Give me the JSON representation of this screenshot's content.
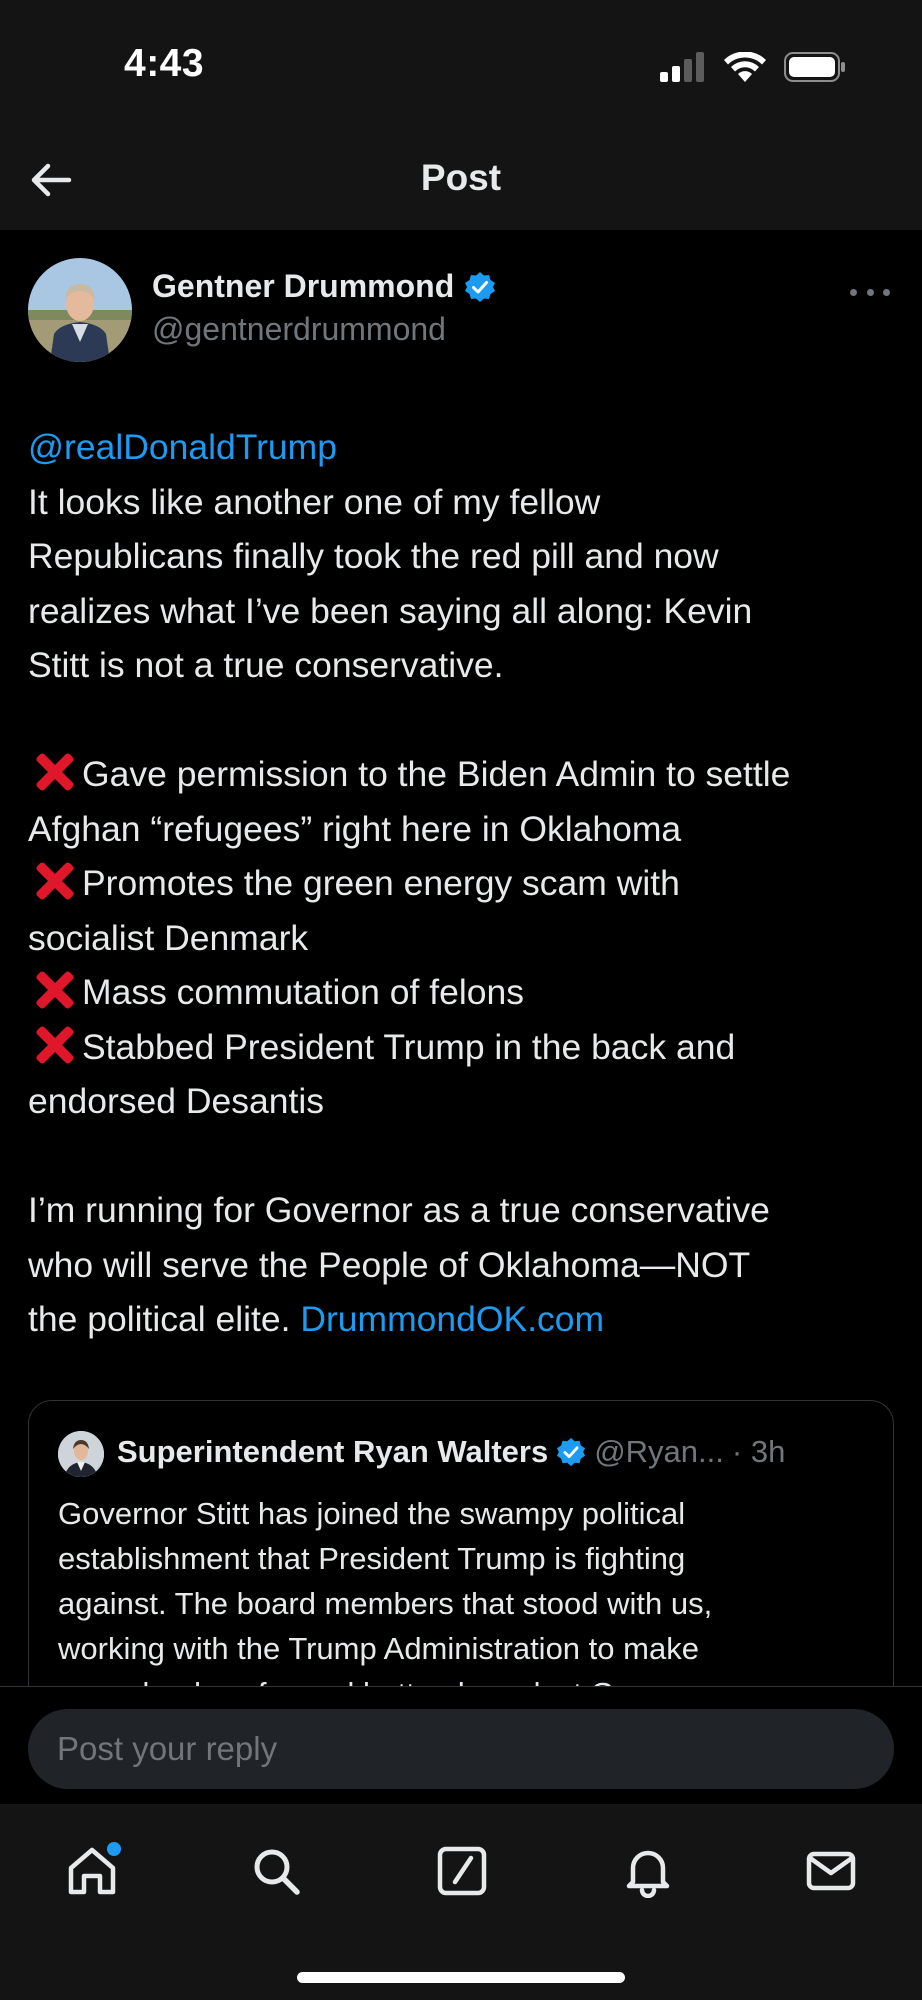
{
  "status_bar": {
    "time": "4:43"
  },
  "header": {
    "title": "Post"
  },
  "post": {
    "author_name": "Gentner Drummond",
    "author_handle": "@gentnerdrummond",
    "mention": "@realDonaldTrump",
    "intro_lines": [
      "It looks like another one of my fellow",
      "Republicans finally took the red pill and now",
      "realizes what I’ve been saying all along: Kevin",
      "Stitt is not a true conservative."
    ],
    "bullets": {
      "b1_line1": "Gave permission to the Biden Admin to settle",
      "b1_line2": "Afghan “refugees” right here in Oklahoma",
      "b2_line1": "Promotes the green energy scam with",
      "b2_line2": "socialist Denmark",
      "b3_line1": "Mass commutation of felons",
      "b4_line1": "Stabbed President Trump in the back and",
      "b4_line2": "endorsed Desantis"
    },
    "closing_lines": [
      "I’m running for Governor as a true conservative",
      "who will serve the People of Oklahoma—NOT",
      "the political elite. "
    ],
    "closing_link": "DrummondOK.com"
  },
  "quote": {
    "author_name": "Superintendent Ryan Walters",
    "author_handle": "@Ryan...",
    "time": "· 3h",
    "lines": [
      "Governor Stitt has joined the swampy political",
      "establishment that President Trump is fighting",
      "against. The board members that stood with us,",
      "working with the Trump Administration to make",
      "our schools safer and better, have lost Gov..."
    ]
  },
  "reply": {
    "placeholder": "Post your reply"
  },
  "tabs": [
    "home",
    "search",
    "compose",
    "notifications",
    "messages"
  ],
  "colors": {
    "accent": "#1d9bf0",
    "xmark": "#e0162b",
    "background": "#000000",
    "bar": "#141414"
  }
}
